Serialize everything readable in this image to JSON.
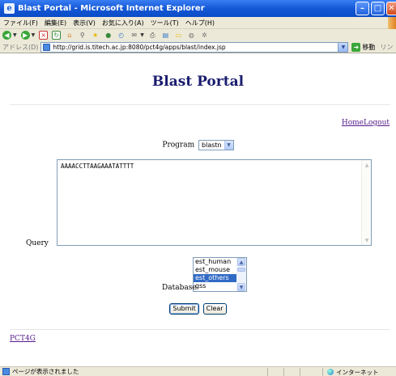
{
  "window": {
    "title": "Blast Portal - Microsoft Internet Explorer",
    "buttons": {
      "minimize": "–",
      "maximize": "□",
      "close": "✕"
    }
  },
  "menubar": {
    "items": [
      "ファイル(F)",
      "編集(E)",
      "表示(V)",
      "お気に入り(A)",
      "ツール(T)",
      "ヘルプ(H)"
    ]
  },
  "addressbar": {
    "label": "アドレス(D)",
    "url": "http://grid.is.titech.ac.jp:8080/pct4g/apps/blast/index.jsp",
    "go_label": "移動",
    "links_label": "リン"
  },
  "page": {
    "title": "Blast Portal",
    "links": {
      "home": "Home",
      "logout": "Logout"
    },
    "program": {
      "label": "Program",
      "selected": "blastn"
    },
    "query": {
      "label": "Query",
      "value": "AAAACCTTAAGAAATATTTT"
    },
    "database": {
      "label": "Database",
      "options": [
        "est_human",
        "est_mouse",
        "est_others",
        "gss"
      ],
      "selected": "est_others"
    },
    "buttons": {
      "submit": "Submit",
      "clear": "Clear"
    },
    "footer_link": "PCT4G"
  },
  "statusbar": {
    "text": "ページが表示されました",
    "zone": "インターネット"
  },
  "colors": {
    "title_text": "#1a1c6e",
    "visited_link": "#551a8b",
    "titlebar_blue": "#1458d6",
    "selection_blue": "#316ac5"
  }
}
